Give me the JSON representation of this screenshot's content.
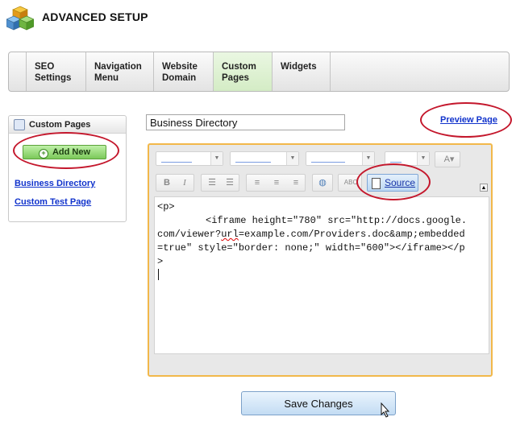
{
  "header": {
    "title": "ADVANCED SETUP",
    "logo_icon": "stacked-cubes-icon"
  },
  "tabs": [
    {
      "label": "SEO\nSettings",
      "active": false
    },
    {
      "label": "Navigation\nMenu",
      "active": false
    },
    {
      "label": "Website\nDomain",
      "active": false
    },
    {
      "label": "Custom\nPages",
      "active": true
    },
    {
      "label": "Widgets",
      "active": false
    }
  ],
  "sidebar": {
    "title": "Custom Pages",
    "add_button": "Add New",
    "pages": [
      "Business Directory",
      "Custom Test Page"
    ]
  },
  "editor": {
    "page_name": "Business Directory",
    "preview_link": "Preview Page",
    "source_button": "Source",
    "code_lines": [
      "<p>",
      "\t<iframe height=\"780\" src=\"http://docs.google.",
      "com/viewer?url=example.com/Providers.doc&amp;embedded",
      "=true\" style=\"border: none;\" width=\"600\"></iframe></p",
      ">"
    ]
  },
  "footer": {
    "save_button": "Save Changes"
  },
  "colors": {
    "highlight_circle": "#c4172c",
    "editor_border": "#f2b84a",
    "active_tab": "#d4ecc5",
    "link": "#1133cc"
  }
}
